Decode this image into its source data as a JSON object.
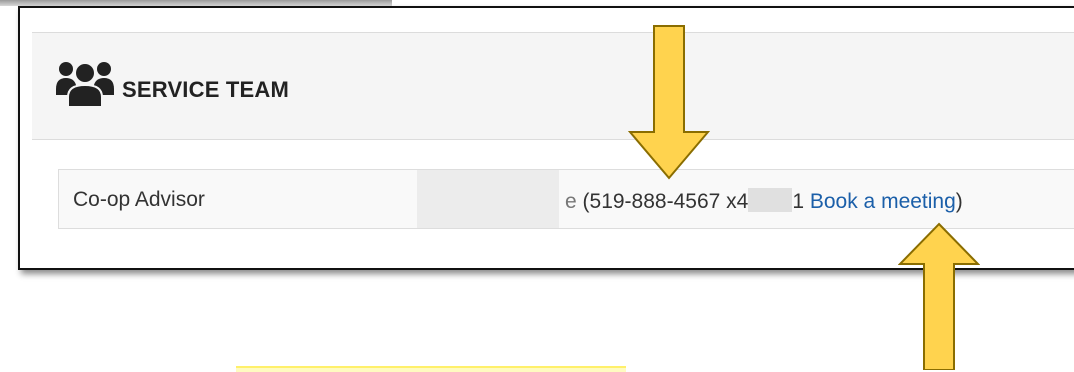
{
  "panel": {
    "title": "SERVICE TEAM",
    "icon": "users-group-icon"
  },
  "team": {
    "rows": [
      {
        "role": "Co-op Advisor",
        "name_fragment": "e",
        "phone_prefix": "(519-888-4567 x4",
        "phone_suffix": "1",
        "link_label": "Book a meeting",
        "close_paren": ")"
      }
    ]
  },
  "annotations": {
    "arrows": [
      "down-arrow",
      "up-arrow"
    ],
    "arrow_color": "#ffd34e",
    "arrow_outline": "#8a6d00",
    "highlight_color": "#fffbc0"
  },
  "colors": {
    "link": "#1b5fa9",
    "heading_bg": "#f5f5f5",
    "table_bg": "#f9f9f9"
  }
}
